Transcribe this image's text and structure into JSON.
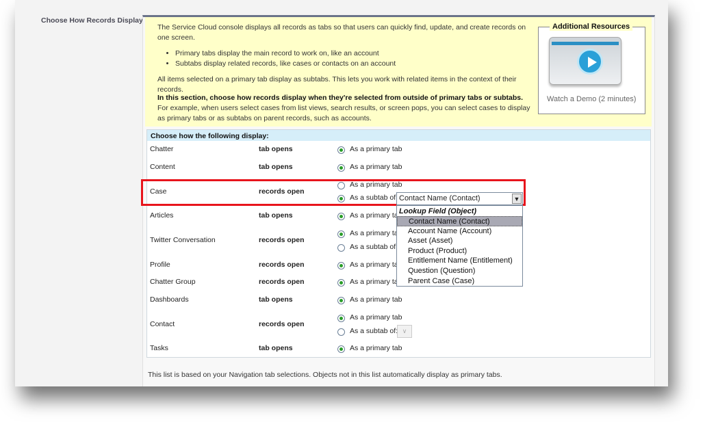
{
  "section_label": "Choose How Records Display",
  "intro": {
    "p1": "The Service Cloud console displays all records as tabs so that users can quickly find, update, and create records on one screen.",
    "bullets": [
      "Primary tabs display the main record to work on, like an account",
      "Subtabs display related records, like cases or contacts on an account"
    ],
    "p2": "All items selected on a primary tab display as subtabs. This lets you work with related items in the context of their records.",
    "p3_bold": "In this section, choose how records display when they're selected from outside of primary tabs or subtabs.",
    "p3_rest": " For example, when users select cases from list views, search results, or screen pops, you can select cases to display as primary tabs or as subtabs on parent records, such as accounts."
  },
  "resources": {
    "title": "Additional Resources",
    "link": "Watch a Demo (2 minutes)",
    "thumbnail_icon": "play-video-icon"
  },
  "table": {
    "header": "Choose how the following display:",
    "primary_label": "As a primary tab",
    "subtab_label": "As a subtab of:",
    "rows": [
      {
        "name": "Chatter",
        "action": "tab opens",
        "selected": "primary"
      },
      {
        "name": "Content",
        "action": "tab opens",
        "selected": "primary"
      },
      {
        "name": "Case",
        "action": "records open",
        "selected": "subtab",
        "subtab_value": "Contact Name (Contact)"
      },
      {
        "name": "Articles",
        "action": "tab opens",
        "selected": "primary"
      },
      {
        "name": "Twitter Conversation",
        "action": "records open",
        "selected": "primary"
      },
      {
        "name": "Profile",
        "action": "records open",
        "selected": "primary"
      },
      {
        "name": "Chatter Group",
        "action": "records open",
        "selected": "primary"
      },
      {
        "name": "Dashboards",
        "action": "tab opens",
        "selected": "primary"
      },
      {
        "name": "Contact",
        "action": "records open",
        "selected": "primary"
      },
      {
        "name": "Tasks",
        "action": "tab opens",
        "selected": "primary"
      }
    ]
  },
  "dropdown": {
    "group": "Lookup Field (Object)",
    "options": [
      "Contact Name (Contact)",
      "Account Name (Account)",
      "Asset (Asset)",
      "Product (Product)",
      "Entitlement Name (Entitlement)",
      "Question (Question)",
      "Parent Case (Case)"
    ],
    "selected": "Contact Name (Contact)"
  },
  "footer": "This list is based on your Navigation tab selections. Objects not in this list automatically display as primary tabs.",
  "colors": {
    "highlight": "#e8141c",
    "intro_bg": "#ffffc9",
    "header_bg": "#d6eef9"
  }
}
